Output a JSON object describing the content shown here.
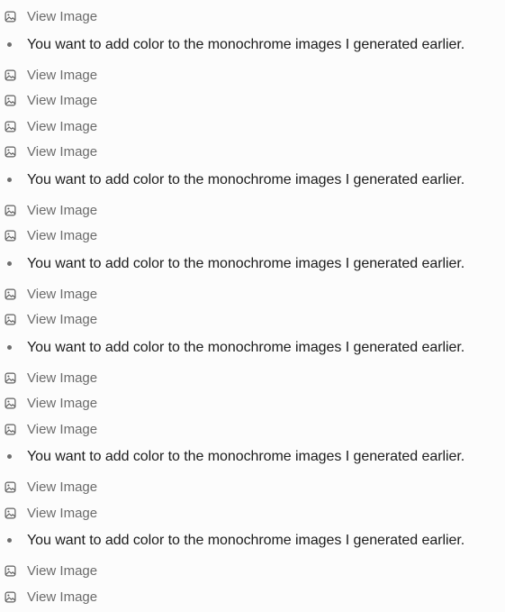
{
  "icons": {
    "image": "image-icon",
    "bullet": "bullet-dot"
  },
  "colors": {
    "background": "#fcfcfc",
    "link_text": "#6b6b6b",
    "message_text": "#1c1c1c",
    "bullet": "#6e6e6e"
  },
  "feed": [
    {
      "type": "image",
      "label": "View Image"
    },
    {
      "type": "message",
      "text": "You want to add color to the monochrome images I generated earlier."
    },
    {
      "type": "image",
      "label": "View Image"
    },
    {
      "type": "image",
      "label": "View Image"
    },
    {
      "type": "image",
      "label": "View Image"
    },
    {
      "type": "image",
      "label": "View Image"
    },
    {
      "type": "message",
      "text": "You want to add color to the monochrome images I generated earlier."
    },
    {
      "type": "image",
      "label": "View Image"
    },
    {
      "type": "image",
      "label": "View Image"
    },
    {
      "type": "message",
      "text": "You want to add color to the monochrome images I generated earlier."
    },
    {
      "type": "image",
      "label": "View Image"
    },
    {
      "type": "image",
      "label": "View Image"
    },
    {
      "type": "message",
      "text": "You want to add color to the monochrome images I generated earlier."
    },
    {
      "type": "image",
      "label": "View Image"
    },
    {
      "type": "image",
      "label": "View Image"
    },
    {
      "type": "image",
      "label": "View Image"
    },
    {
      "type": "message",
      "text": "You want to add color to the monochrome images I generated earlier."
    },
    {
      "type": "image",
      "label": "View Image"
    },
    {
      "type": "image",
      "label": "View Image"
    },
    {
      "type": "message",
      "text": "You want to add color to the monochrome images I generated earlier."
    },
    {
      "type": "image",
      "label": "View Image"
    },
    {
      "type": "image",
      "label": "View Image"
    }
  ]
}
